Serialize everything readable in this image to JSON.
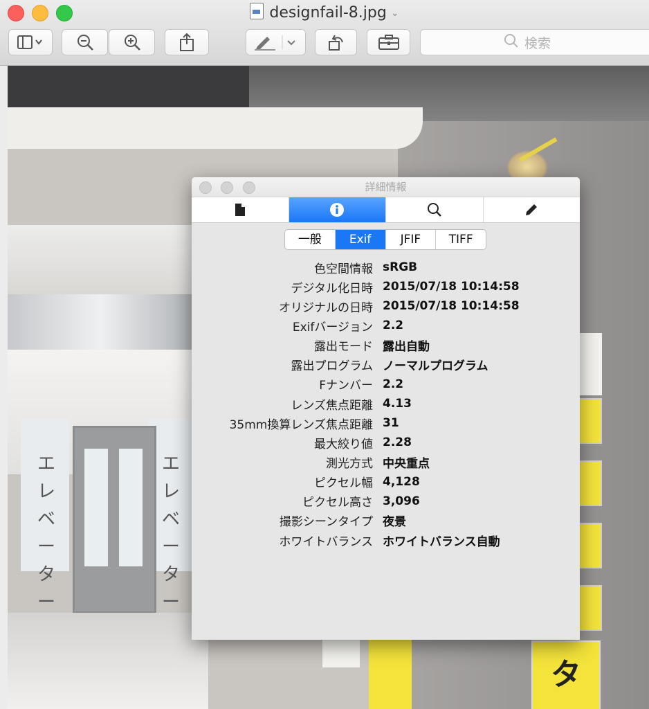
{
  "window": {
    "title": "designfail-8.jpg",
    "search_placeholder": "検索"
  },
  "inspector": {
    "title": "詳細情報",
    "segments": [
      "一般",
      "Exif",
      "JFIF",
      "TIFF"
    ],
    "active_segment": "Exif",
    "rows": [
      {
        "label": "色空間情報",
        "value": "sRGB"
      },
      {
        "label": "デジタル化日時",
        "value": "2015/07/18 10:14:58"
      },
      {
        "label": "オリジナルの日時",
        "value": "2015/07/18 10:14:58"
      },
      {
        "label": "Exifバージョン",
        "value": "2.2"
      },
      {
        "label": "露出モード",
        "value": "露出自動"
      },
      {
        "label": "露出プログラム",
        "value": "ノーマルプログラム"
      },
      {
        "label": "Fナンバー",
        "value": "2.2"
      },
      {
        "label": "レンズ焦点距離",
        "value": "4.13"
      },
      {
        "label": "35mm換算レンズ焦点距離",
        "value": "31"
      },
      {
        "label": "最大絞り値",
        "value": "2.28"
      },
      {
        "label": "測光方式",
        "value": "中央重点"
      },
      {
        "label": "ピクセル幅",
        "value": "4,128"
      },
      {
        "label": "ピクセル高さ",
        "value": "3,096"
      },
      {
        "label": "撮影シーンタイプ",
        "value": "夜景"
      },
      {
        "label": "ホワイトバランス",
        "value": "ホワイトバランス自動"
      }
    ]
  },
  "photo_text": {
    "elevator_left": "エレベーター",
    "elevator_right": "エレベーター",
    "sign_bottom": "タ"
  },
  "colors": {
    "accent": "#1a77f5"
  }
}
